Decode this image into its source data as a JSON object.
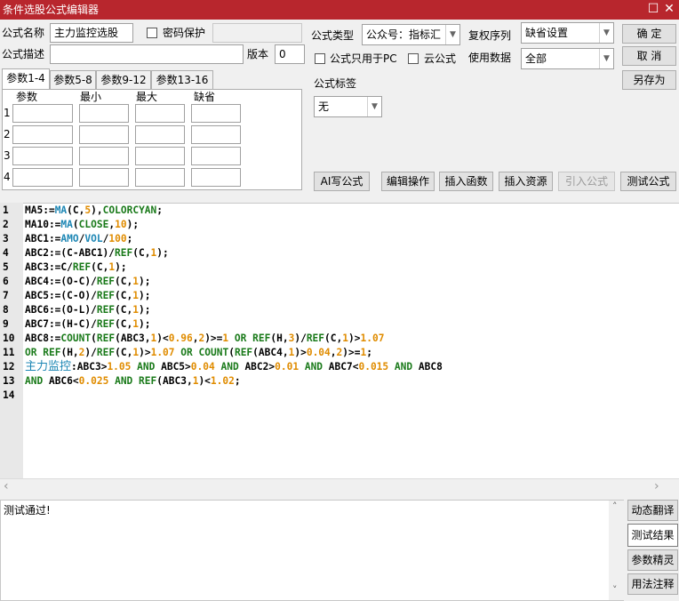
{
  "window": {
    "title": "条件选股公式编辑器",
    "restore_glyph": "☐",
    "close_glyph": "✕"
  },
  "form": {
    "name_label": "公式名称",
    "name_value": "主力监控选股",
    "password_label": "密码保护",
    "password_value": "",
    "desc_label": "公式描述",
    "desc_value": "",
    "version_label": "版本",
    "version_value": "0",
    "type_label": "公式类型",
    "type_value": "公众号：指标汇",
    "pc_only_label": "公式只用于PC",
    "cloud_label": "云公式",
    "restore_label": "复权序列",
    "restore_value": "缺省设置",
    "usedata_label": "使用数据",
    "usedata_value": "全部",
    "tag_label": "公式标签",
    "tag_value": "无"
  },
  "buttons": {
    "ok": "确  定",
    "cancel": "取  消",
    "save_as": "另存为",
    "ai": "AI写公式",
    "edit": "编辑操作",
    "insert_func": "插入函数",
    "insert_res": "插入资源",
    "import": "引入公式",
    "test": "测试公式"
  },
  "tabs": [
    "参数1-4",
    "参数5-8",
    "参数9-12",
    "参数13-16"
  ],
  "params": {
    "headers": [
      "参数",
      "最小",
      "最大",
      "缺省"
    ],
    "rows": [
      "1",
      "2",
      "3",
      "4"
    ]
  },
  "code_lines": [
    {
      "n": "1",
      "tokens": [
        [
          "var",
          "MA5:="
        ],
        [
          "fn",
          "MA"
        ],
        [
          "sym",
          "("
        ],
        [
          "var",
          "C"
        ],
        [
          "sym",
          ","
        ],
        [
          "num",
          "5"
        ],
        [
          "sym",
          "),"
        ],
        [
          "fn2",
          "COLORCYAN"
        ],
        [
          "sym",
          ";"
        ]
      ]
    },
    {
      "n": "2",
      "tokens": [
        [
          "var",
          "MA10:="
        ],
        [
          "fn",
          "MA"
        ],
        [
          "sym",
          "("
        ],
        [
          "fn2",
          "CLOSE"
        ],
        [
          "sym",
          ","
        ],
        [
          "num",
          "10"
        ],
        [
          "sym",
          ");"
        ]
      ]
    },
    {
      "n": "3",
      "tokens": [
        [
          "var",
          "ABC1:="
        ],
        [
          "fn",
          "AMO"
        ],
        [
          "sym",
          "/"
        ],
        [
          "fn",
          "VOL"
        ],
        [
          "sym",
          "/"
        ],
        [
          "num",
          "100"
        ],
        [
          "sym",
          ";"
        ]
      ]
    },
    {
      "n": "4",
      "tokens": [
        [
          "var",
          "ABC2:=(C-ABC1)/"
        ],
        [
          "fn2",
          "REF"
        ],
        [
          "sym",
          "(C,"
        ],
        [
          "num",
          "1"
        ],
        [
          "sym",
          ");"
        ]
      ]
    },
    {
      "n": "5",
      "tokens": [
        [
          "var",
          "ABC3:=C/"
        ],
        [
          "fn2",
          "REF"
        ],
        [
          "sym",
          "(C,"
        ],
        [
          "num",
          "1"
        ],
        [
          "sym",
          ");"
        ]
      ]
    },
    {
      "n": "6",
      "tokens": [
        [
          "var",
          "ABC4:=(O-C)/"
        ],
        [
          "fn2",
          "REF"
        ],
        [
          "sym",
          "(C,"
        ],
        [
          "num",
          "1"
        ],
        [
          "sym",
          ");"
        ]
      ]
    },
    {
      "n": "7",
      "tokens": [
        [
          "var",
          "ABC5:=(C-O)/"
        ],
        [
          "fn2",
          "REF"
        ],
        [
          "sym",
          "(C,"
        ],
        [
          "num",
          "1"
        ],
        [
          "sym",
          ");"
        ]
      ]
    },
    {
      "n": "8",
      "tokens": [
        [
          "var",
          "ABC6:=(O-L)/"
        ],
        [
          "fn2",
          "REF"
        ],
        [
          "sym",
          "(C,"
        ],
        [
          "num",
          "1"
        ],
        [
          "sym",
          ");"
        ]
      ]
    },
    {
      "n": "9",
      "tokens": [
        [
          "var",
          "ABC7:=(H-C)/"
        ],
        [
          "fn2",
          "REF"
        ],
        [
          "sym",
          "(C,"
        ],
        [
          "num",
          "1"
        ],
        [
          "sym",
          ");"
        ]
      ]
    },
    {
      "n": "10",
      "tokens": [
        [
          "var",
          "ABC8:="
        ],
        [
          "fn2",
          "COUNT"
        ],
        [
          "sym",
          "("
        ],
        [
          "fn2",
          "REF"
        ],
        [
          "sym",
          "(ABC3,"
        ],
        [
          "num",
          "1"
        ],
        [
          "sym",
          ")<"
        ],
        [
          "num",
          "0.96"
        ],
        [
          "sym",
          ","
        ],
        [
          "num",
          "2"
        ],
        [
          "sym",
          ")>="
        ],
        [
          "num",
          "1"
        ],
        [
          "sym",
          " "
        ],
        [
          "fn2",
          "OR"
        ],
        [
          "sym",
          " "
        ],
        [
          "fn2",
          "REF"
        ],
        [
          "sym",
          "(H,"
        ],
        [
          "num",
          "3"
        ],
        [
          "sym",
          ")/"
        ],
        [
          "fn2",
          "REF"
        ],
        [
          "sym",
          "(C,"
        ],
        [
          "num",
          "1"
        ],
        [
          "sym",
          ")>"
        ],
        [
          "num",
          "1.07"
        ]
      ]
    },
    {
      "n": "11",
      "tokens": [
        [
          "fn2",
          "OR"
        ],
        [
          "sym",
          " "
        ],
        [
          "fn2",
          "REF"
        ],
        [
          "sym",
          "(H,"
        ],
        [
          "num",
          "2"
        ],
        [
          "sym",
          ")/"
        ],
        [
          "fn2",
          "REF"
        ],
        [
          "sym",
          "(C,"
        ],
        [
          "num",
          "1"
        ],
        [
          "sym",
          ")>"
        ],
        [
          "num",
          "1.07"
        ],
        [
          "sym",
          " "
        ],
        [
          "fn2",
          "OR"
        ],
        [
          "sym",
          " "
        ],
        [
          "fn2",
          "COUNT"
        ],
        [
          "sym",
          "("
        ],
        [
          "fn2",
          "REF"
        ],
        [
          "sym",
          "(ABC4,"
        ],
        [
          "num",
          "1"
        ],
        [
          "sym",
          ")>"
        ],
        [
          "num",
          "0.04"
        ],
        [
          "sym",
          ","
        ],
        [
          "num",
          "2"
        ],
        [
          "sym",
          ")>="
        ],
        [
          "num",
          "1"
        ],
        [
          "sym",
          ";"
        ]
      ]
    },
    {
      "n": "12",
      "tokens": [
        [
          "cn",
          "主力监控"
        ],
        [
          "sym",
          ":ABC3>"
        ],
        [
          "num",
          "1.05"
        ],
        [
          "sym",
          " "
        ],
        [
          "fn2",
          "AND"
        ],
        [
          "sym",
          " ABC5>"
        ],
        [
          "num",
          "0.04"
        ],
        [
          "sym",
          " "
        ],
        [
          "fn2",
          "AND"
        ],
        [
          "sym",
          " ABC2>"
        ],
        [
          "num",
          "0.01"
        ],
        [
          "sym",
          " "
        ],
        [
          "fn2",
          "AND"
        ],
        [
          "sym",
          " ABC7<"
        ],
        [
          "num",
          "0.015"
        ],
        [
          "sym",
          " "
        ],
        [
          "fn2",
          "AND"
        ],
        [
          "sym",
          " ABC8"
        ]
      ]
    },
    {
      "n": "13",
      "tokens": [
        [
          "fn2",
          "AND"
        ],
        [
          "sym",
          " ABC6<"
        ],
        [
          "num",
          "0.025"
        ],
        [
          "sym",
          " "
        ],
        [
          "fn2",
          "AND"
        ],
        [
          "sym",
          " "
        ],
        [
          "fn2",
          "REF"
        ],
        [
          "sym",
          "(ABC3,"
        ],
        [
          "num",
          "1"
        ],
        [
          "sym",
          ")<"
        ],
        [
          "num",
          "1.02"
        ],
        [
          "sym",
          ";"
        ]
      ]
    },
    {
      "n": "14",
      "tokens": []
    }
  ],
  "output_text": "测试通过!",
  "side_buttons": [
    "动态翻译",
    "测试结果",
    "参数精灵",
    "用法注释"
  ],
  "icons": {
    "combo_arrow": "▼",
    "scroll_left": "‹",
    "scroll_right": "›",
    "scroll_up": "˄",
    "scroll_down": "˅"
  }
}
